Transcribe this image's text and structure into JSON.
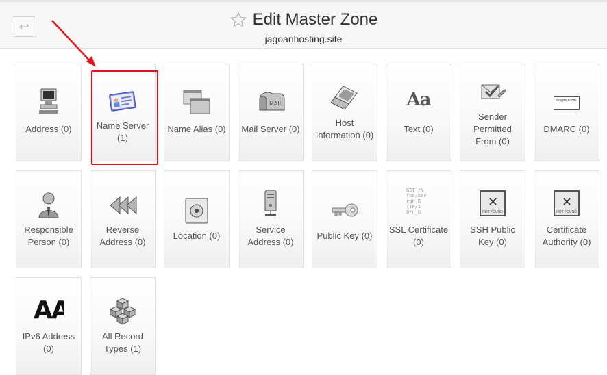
{
  "header": {
    "back_symbol": "↩",
    "title": "Edit Master Zone",
    "subtitle": "jagoanhosting.site"
  },
  "tiles": [
    {
      "icon": "computer-icon",
      "line1": "Address (0)",
      "line2": ""
    },
    {
      "icon": "id-card-icon",
      "line1": "Name Server",
      "line2": "(1)"
    },
    {
      "icon": "windows-icon",
      "line1": "Name Alias (0)",
      "line2": ""
    },
    {
      "icon": "mailbox-icon",
      "line1": "Mail Server (0)",
      "line2": ""
    },
    {
      "icon": "laptop-icon",
      "line1": "Host",
      "line2": "Information (0)"
    },
    {
      "icon": "text-icon",
      "line1": "Text (0)",
      "line2": "",
      "icon_text": "Aa"
    },
    {
      "icon": "sender-check-icon",
      "line1": "Sender",
      "line2": "Permitted",
      "line3": "From (0)"
    },
    {
      "icon": "dmarc-icon",
      "line1": "DMARC (0)",
      "line2": "",
      "icon_text": "foo@bar.com"
    },
    {
      "icon": "person-icon",
      "line1": "Responsible",
      "line2": "Person (0)"
    },
    {
      "icon": "rewind-icon",
      "line1": "Reverse",
      "line2": "Address (0)"
    },
    {
      "icon": "location-icon",
      "line1": "Location (0)",
      "line2": ""
    },
    {
      "icon": "server-icon",
      "line1": "Service",
      "line2": "Address (0)"
    },
    {
      "icon": "key-icon",
      "line1": "Public Key (0)",
      "line2": ""
    },
    {
      "icon": "certificate-text-icon",
      "line1": "SSL Certificate",
      "line2": "(0)"
    },
    {
      "icon": "not-found-icon",
      "line1": "SSH Public",
      "line2": "Key (0)",
      "icon_text": "NOT FOUND"
    },
    {
      "icon": "not-found-icon",
      "line1": "Certificate",
      "line2": "Authority (0)",
      "icon_text": "NOT FOUND"
    },
    {
      "icon": "ipv6-icon",
      "line1": "IPv6 Address",
      "line2": "(0)",
      "icon_text": "AA"
    },
    {
      "icon": "cubes-icon",
      "line1": "All Record",
      "line2": "Types (1)"
    }
  ],
  "colors": {
    "highlight": "#e0141a",
    "header_bg": "#f6f6f6",
    "tile_border": "#e2e2e2"
  }
}
